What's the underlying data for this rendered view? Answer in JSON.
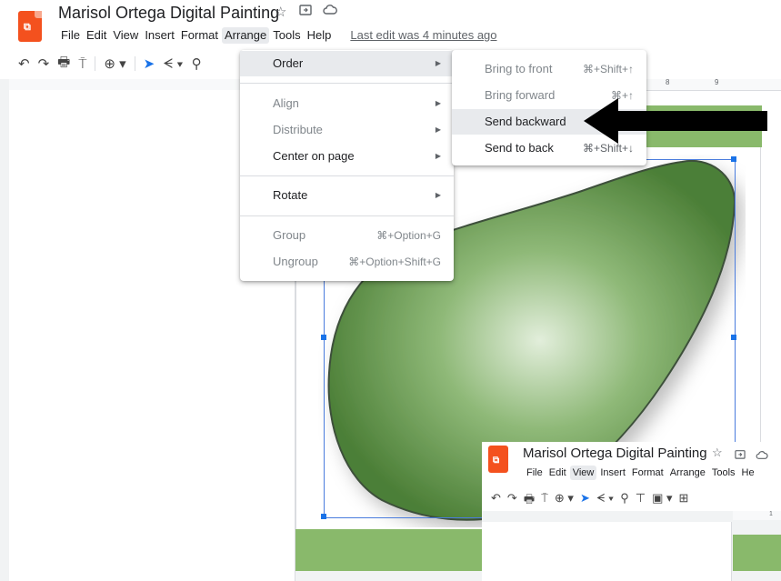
{
  "app": {
    "title": "Marisol Ortega Digital Painting",
    "star_icon": "star-icon",
    "move_icon": "folder-move-icon",
    "cloud_icon": "cloud-status-icon",
    "last_edit": "Last edit was 4 minutes ago"
  },
  "menubar": [
    "File",
    "Edit",
    "View",
    "Insert",
    "Format",
    "Arrange",
    "Tools",
    "Help"
  ],
  "arrange_menu": {
    "items": [
      {
        "label": "Order",
        "enabled": true,
        "submenu": true
      },
      {
        "label": "Align",
        "enabled": false,
        "submenu": true
      },
      {
        "label": "Distribute",
        "enabled": false,
        "submenu": true
      },
      {
        "label": "Center on page",
        "enabled": true,
        "submenu": true
      },
      {
        "label": "Rotate",
        "enabled": true,
        "submenu": true
      },
      {
        "label": "Group",
        "enabled": false,
        "shortcut": "⌘+Option+G"
      },
      {
        "label": "Ungroup",
        "enabled": false,
        "shortcut": "⌘+Option+Shift+G"
      }
    ]
  },
  "order_submenu": {
    "items": [
      {
        "label": "Bring to front",
        "shortcut": "⌘+Shift+↑",
        "enabled": false
      },
      {
        "label": "Bring forward",
        "shortcut": "⌘+↑",
        "enabled": false
      },
      {
        "label": "Send backward",
        "shortcut": "",
        "enabled": true
      },
      {
        "label": "Send to back",
        "shortcut": "⌘+Shift+↓",
        "enabled": true
      }
    ]
  },
  "ruler_marks": {
    "eight": "8",
    "nine": "9",
    "one": "1"
  },
  "second_window": {
    "title": "Marisol Ortega Digital Painting",
    "menubar": [
      "File",
      "Edit",
      "View",
      "Insert",
      "Format",
      "Arrange",
      "Tools",
      "He"
    ]
  },
  "colors": {
    "accent": "#1a73e8",
    "logo": "#f4511e",
    "slide_green": "#89b96b"
  }
}
